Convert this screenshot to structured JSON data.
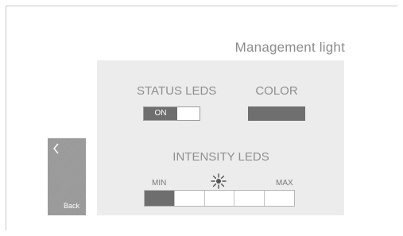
{
  "header": {
    "title": "Management light"
  },
  "status_leds": {
    "label": "STATUS LEDS",
    "toggle_state": "ON"
  },
  "color": {
    "label": "COLOR",
    "swatch_color": "#6f6f6f"
  },
  "intensity_leds": {
    "label": "INTENSITY LEDS",
    "min_label": "MIN",
    "max_label": "MAX",
    "icon": "brightness-icon",
    "level": 1,
    "max_level": 5
  },
  "navigation": {
    "back_label": "Back",
    "back_icon": "chevron-left-icon"
  },
  "colors": {
    "accent_dark": "#6e6e6e",
    "panel_bg": "#ececec",
    "label_text": "#8f8f8f"
  }
}
